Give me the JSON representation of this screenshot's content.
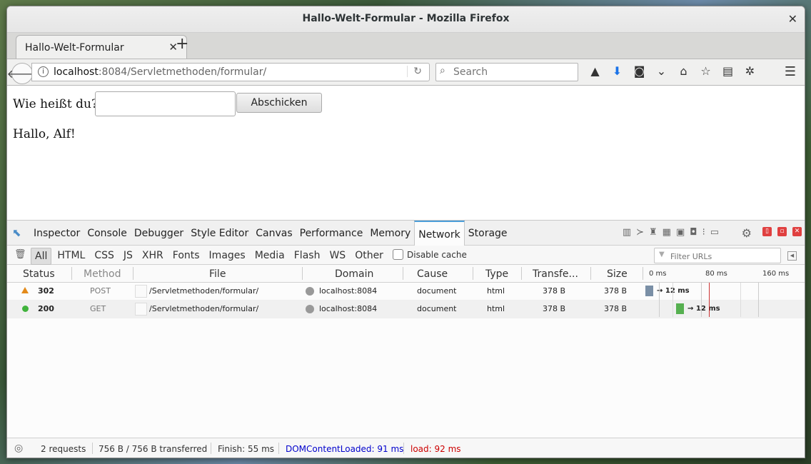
{
  "window": {
    "title": "Hallo-Welt-Formular - Mozilla Firefox",
    "close_symbol": "✕"
  },
  "tab": {
    "label": "Hallo-Welt-Formular",
    "close_symbol": "✕",
    "new_tab_symbol": "+"
  },
  "navbar": {
    "back_symbol": "🡐",
    "info_symbol": "i",
    "url_host": "localhost",
    "url_rest": ":8084/Servletmethoden/formular/",
    "reload_symbol": "↻",
    "search_placeholder": "Search",
    "menu_symbol": "☰"
  },
  "page": {
    "question_label": "Wie heißt du?",
    "name_value": "",
    "submit_label": "Abschicken",
    "greeting": "Hallo, Alf!"
  },
  "devtools": {
    "tabs": [
      "Inspector",
      "Console",
      "Debugger",
      "Style Editor",
      "Canvas",
      "Performance",
      "Memory",
      "Network",
      "Storage"
    ],
    "active_tab": "Network",
    "filter_tabs": [
      "All",
      "HTML",
      "CSS",
      "JS",
      "XHR",
      "Fonts",
      "Images",
      "Media",
      "Flash",
      "WS",
      "Other"
    ],
    "active_filter": "All",
    "disable_cache_label": "Disable cache",
    "filter_placeholder": "Filter URLs",
    "columns": [
      "Status",
      "Method",
      "File",
      "Domain",
      "Cause",
      "Type",
      "Transfe...",
      "Size"
    ],
    "timeline_ticks": [
      "0 ms",
      "80 ms",
      "160 ms"
    ],
    "requests": [
      {
        "status": "302",
        "method": "POST",
        "file": "/Servletmethoden/formular/",
        "domain": "localhost:8084",
        "cause": "document",
        "type": "html",
        "transferred": "378 B",
        "size": "378 B",
        "timing": "→ 12 ms",
        "status_kind": "redirect"
      },
      {
        "status": "200",
        "method": "GET",
        "file": "/Servletmethoden/formular/",
        "domain": "localhost:8084",
        "cause": "document",
        "type": "html",
        "transferred": "378 B",
        "size": "378 B",
        "timing": "→ 12 ms",
        "status_kind": "ok"
      }
    ],
    "statusbar": {
      "requests": "2 requests",
      "transferred": "756 B / 756 B transferred",
      "finish": "Finish: 55 ms",
      "domcontentloaded": "DOMContentLoaded: 91 ms",
      "load": "load: 92 ms"
    }
  },
  "colors": {
    "dom_content_loaded": "#0000cc",
    "load": "#cc0000",
    "warning": "#e38a1a",
    "ok": "#40b33c",
    "active_tab_accent": "#4c9ed9"
  }
}
